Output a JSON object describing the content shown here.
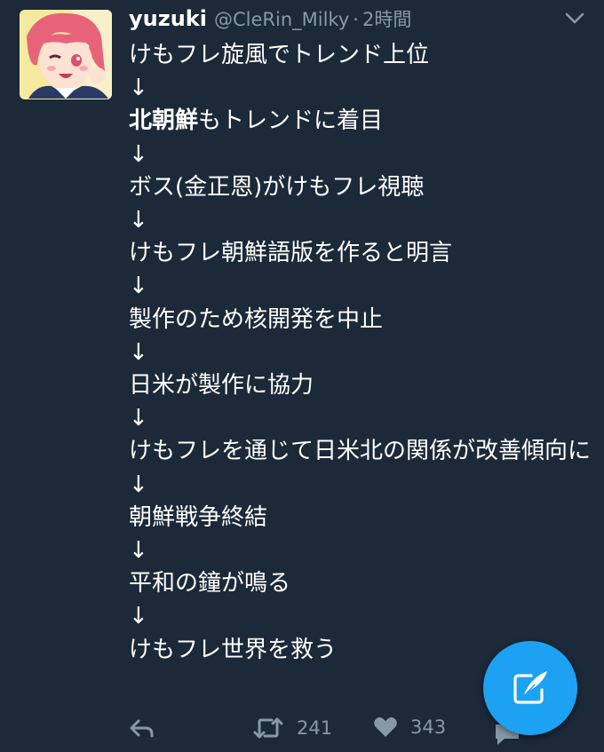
{
  "user": {
    "name": "yuzuki",
    "handle": "@CleRin_Milky",
    "separator": "·",
    "time": "2時間"
  },
  "tweet": {
    "lines": [
      "けもフレ旋風でトレンド上位",
      "↓",
      "北朝鮮",
      "もトレンドに着目",
      "↓",
      "ボス(金正恩)がけもフレ視聴",
      "↓",
      "けもフレ朝鮮語版を作ると明言",
      "↓",
      "製作のため核開発を中止",
      "↓",
      "日米が製作に協力",
      "↓",
      "けもフレを通じて日米北の関係が改善傾向に",
      "↓",
      "朝鮮戦争終結",
      "↓",
      "平和の鐘が鳴る",
      "↓",
      "けもフレ世界を救う"
    ]
  },
  "actions": {
    "retweet_count": "241",
    "like_count": "343"
  },
  "icons": {
    "avatar": "avatar",
    "caret": "chevron-down-icon",
    "reply": "reply-icon",
    "retweet": "retweet-icon",
    "like": "heart-icon",
    "dm": "direct-message-icon",
    "compose": "compose-tweet-icon"
  },
  "colors": {
    "background": "#1c2938",
    "muted": "#8899a6",
    "accent": "#1da1f2"
  }
}
